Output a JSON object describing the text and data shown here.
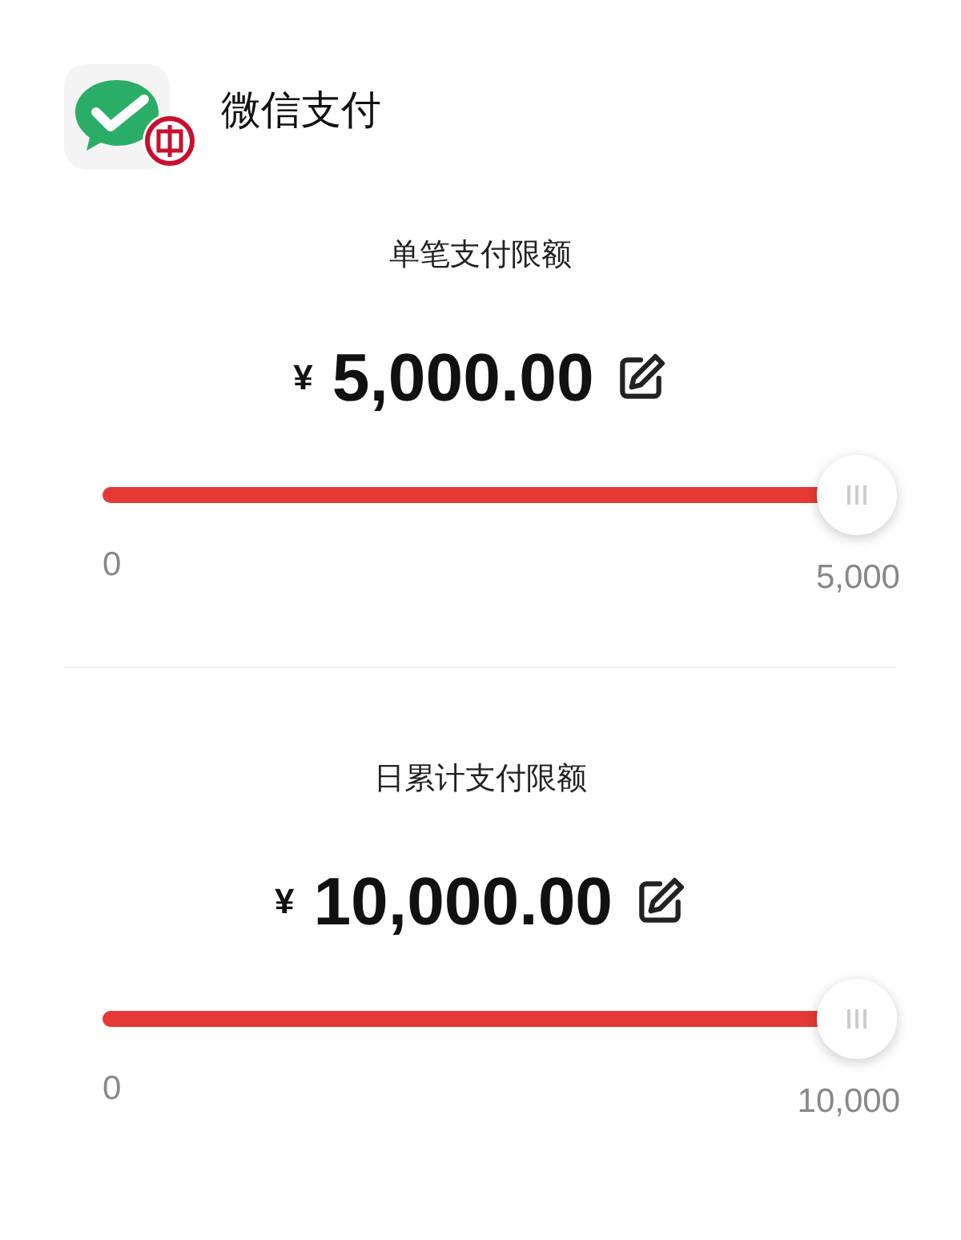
{
  "app": {
    "name": "微信支付"
  },
  "limits": [
    {
      "title": "单笔支付限额",
      "currency": "¥",
      "amount": "5,000.00",
      "level": 1,
      "min_label": "0",
      "max_label": "5,000"
    },
    {
      "title": "日累计支付限额",
      "currency": "¥",
      "amount": "10,000.00",
      "level": 1,
      "min_label": "0",
      "max_label": "10,000"
    }
  ]
}
